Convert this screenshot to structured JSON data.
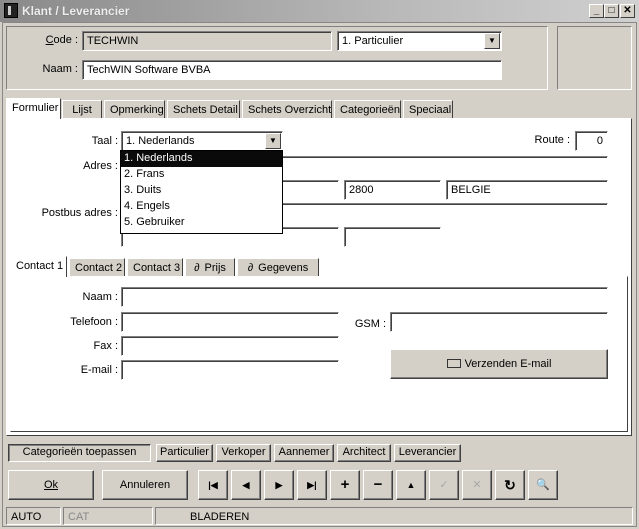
{
  "window": {
    "title": "Klant / Leverancier",
    "controls": {
      "minimize": "_",
      "maximize": "□",
      "close": "✕"
    }
  },
  "header": {
    "code_label": "Code :",
    "code_value": "TECHWIN",
    "type_value": "1.  Particulier",
    "naam_label": "Naam :",
    "naam_value": "TechWIN Software BVBA"
  },
  "main_tabs": [
    {
      "label": "Formulier",
      "active": true
    },
    {
      "label": "Lijst"
    },
    {
      "label": "Opmerking"
    },
    {
      "label": "Schets Detail"
    },
    {
      "label": "Schets Overzicht"
    },
    {
      "label": "Categorieën"
    },
    {
      "label": "Speciaal"
    }
  ],
  "form": {
    "taal_label": "Taal :",
    "taal_value": "1.  Nederlands",
    "taal_options": [
      "1.  Nederlands",
      "2.  Frans",
      "3.  Duits",
      "4.  Engels",
      "5.  Gebruiker"
    ],
    "route_label": "Route :",
    "route_value": "0",
    "adres_label": "Adres :",
    "adres_value": "",
    "postcode": "2800",
    "land": "BELGIE",
    "postbus_label": "Postbus adres :"
  },
  "contact_tabs": [
    {
      "label": "Contact 1",
      "active": true,
      "icon": ""
    },
    {
      "label": "Contact 2",
      "icon": ""
    },
    {
      "label": "Contact 3",
      "icon": ""
    },
    {
      "label": "Prijs",
      "icon": "paperclip-icon"
    },
    {
      "label": "Gegevens",
      "icon": "paperclip-icon"
    }
  ],
  "contact": {
    "naam_label": "Naam :",
    "telefoon_label": "Telefoon :",
    "gsm_label": "GSM :",
    "fax_label": "Fax :",
    "email_label": "E-mail :",
    "send_email_label": "Verzenden E-mail"
  },
  "category_bar": {
    "apply": "Categorieën toepassen",
    "buttons": [
      "Particulier",
      "Verkoper",
      "Aannemer",
      "Architect",
      "Leverancier"
    ]
  },
  "actions": {
    "ok": "Ok",
    "cancel": "Annuleren",
    "nav": [
      {
        "name": "first-record-icon",
        "glyph": "|◀"
      },
      {
        "name": "previous-record-icon",
        "glyph": "◀"
      },
      {
        "name": "next-record-icon",
        "glyph": "▶"
      },
      {
        "name": "last-record-icon",
        "glyph": "▶|"
      },
      {
        "name": "add-record-icon",
        "glyph": "+"
      },
      {
        "name": "delete-record-icon",
        "glyph": "−"
      },
      {
        "name": "edit-record-icon",
        "glyph": "▲"
      },
      {
        "name": "save-record-icon",
        "glyph": "✓",
        "disabled": true
      },
      {
        "name": "cancel-edit-icon",
        "glyph": "✕",
        "disabled": true
      },
      {
        "name": "refresh-icon",
        "glyph": "↻"
      },
      {
        "name": "binoculars-search-icon",
        "glyph": "🔍"
      }
    ]
  },
  "status": {
    "mode": "AUTO",
    "cat": "CAT",
    "state": "BLADEREN"
  }
}
